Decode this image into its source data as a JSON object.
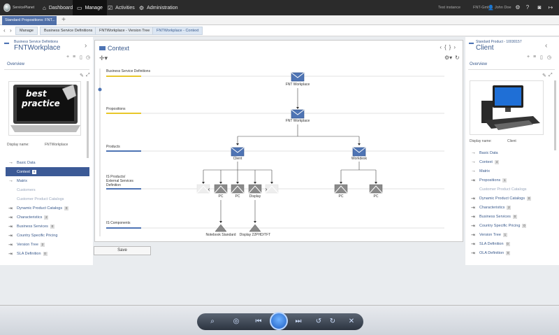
{
  "topbar": {
    "logo_text": "ServicePlanet",
    "nav": [
      {
        "label": "Dashboard",
        "icon": "home-icon"
      },
      {
        "label": "Manage",
        "icon": "laptop-icon"
      },
      {
        "label": "Activities",
        "icon": "checklist-icon"
      },
      {
        "label": "Administration",
        "icon": "gear-icon"
      }
    ],
    "instance": "Test instance",
    "company": "FNT-GmbH",
    "user": "John Doe"
  },
  "tabs": {
    "active_tab": "Standard Propositions: FNT..."
  },
  "breadcrumbs": [
    "Manage",
    "Business Service Definitions",
    "FNTWorkplace - Version Tree",
    "FNTWorkplace - Context"
  ],
  "left_panel": {
    "type": "Business Service Definitions",
    "title": "FNTWorkplace",
    "overview": "Overview",
    "display_label": "Display name:",
    "display_value": "FNTWorkplace",
    "thumbnail_text": [
      "best",
      "practice"
    ],
    "items": [
      {
        "label": "Basic Data",
        "arrow": "→",
        "count": "",
        "state": "normal"
      },
      {
        "label": "Context",
        "arrow": "",
        "count": "8",
        "state": "selected"
      },
      {
        "label": "Matrix",
        "arrow": "→",
        "count": "",
        "state": "normal"
      },
      {
        "label": "Customers",
        "arrow": "",
        "count": "",
        "state": "dim"
      },
      {
        "label": "Customer Product Catalogs",
        "arrow": "",
        "count": "",
        "state": "dim"
      },
      {
        "label": "Dynamic Product Catalogs",
        "arrow": "⇥",
        "count": "0",
        "state": "normal"
      },
      {
        "label": "Characteristics",
        "arrow": "⇥",
        "count": "2",
        "state": "normal"
      },
      {
        "label": "Business Services",
        "arrow": "⇥",
        "count": "0",
        "state": "normal"
      },
      {
        "label": "Country Specific Pricing",
        "arrow": "⇥",
        "count": "",
        "state": "normal"
      },
      {
        "label": "Version Tree",
        "arrow": "⇥",
        "count": "2",
        "state": "normal"
      },
      {
        "label": "SLA Definition",
        "arrow": "⇥",
        "count": "0",
        "state": "normal"
      }
    ]
  },
  "right_panel": {
    "type": "Standard Product - 10030157",
    "title": "Client",
    "overview": "Overview",
    "display_label": "Display name:",
    "display_value": "Client",
    "items": [
      {
        "label": "Basic Data",
        "arrow": "→",
        "count": "",
        "state": "normal"
      },
      {
        "label": "Context",
        "arrow": "→",
        "count": "4",
        "state": "normal"
      },
      {
        "label": "Matrix",
        "arrow": "→",
        "count": "",
        "state": "normal"
      },
      {
        "label": "Propositions",
        "arrow": "⇥",
        "count": "1",
        "state": "normal"
      },
      {
        "label": "Customer Product Catalogs",
        "arrow": "",
        "count": "",
        "state": "dim"
      },
      {
        "label": "Dynamic Product Catalogs",
        "arrow": "⇥",
        "count": "0",
        "state": "normal"
      },
      {
        "label": "Characteristics",
        "arrow": "⇥",
        "count": "2",
        "state": "normal"
      },
      {
        "label": "Business Services",
        "arrow": "⇥",
        "count": "0",
        "state": "normal"
      },
      {
        "label": "Country Specific Pricing",
        "arrow": "⇥",
        "count": "0",
        "state": "normal"
      },
      {
        "label": "Version Tree",
        "arrow": "⇥",
        "count": "1",
        "state": "normal"
      },
      {
        "label": "SLA Definition",
        "arrow": "⇥",
        "count": "0",
        "state": "normal"
      },
      {
        "label": "OLA Definition",
        "arrow": "⇥",
        "count": "0",
        "state": "normal"
      }
    ]
  },
  "context": {
    "title": "Context",
    "layers": [
      "Business Service Definitions",
      "Propositions",
      "Products",
      "IS Products/ External Services Definition",
      "IS Components"
    ],
    "node_labels": {
      "bsd": "FNT Workplace",
      "prop": "FNT Workplace",
      "client": "Client",
      "workdesk": "Workdesk",
      "pc1": "PC",
      "pc2": "PC",
      "display": "Display",
      "pc3": "PC",
      "pc4": "PC",
      "notebook": "Notebook Standard",
      "display2": "Display 22PHD/TFT"
    }
  },
  "save_label": "Save",
  "colors": {
    "accent": "#3a5a8c",
    "selected": "#3c5a96",
    "layer_yellow": "#e8c72a",
    "layer_blue": "#4e74b4"
  }
}
